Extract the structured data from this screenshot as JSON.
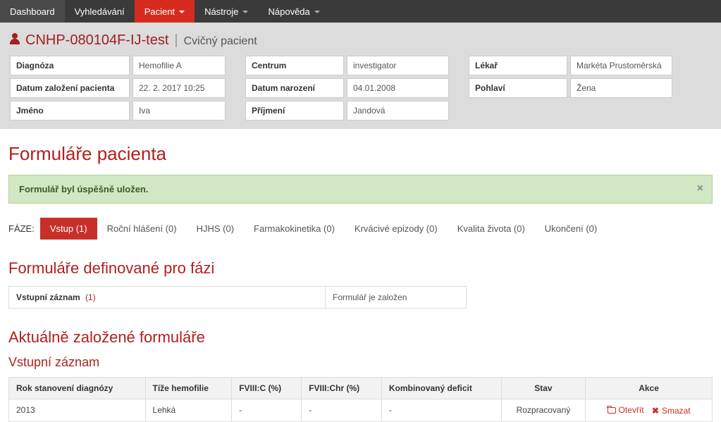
{
  "nav": {
    "dashboard": "Dashboard",
    "search": "Vyhledávání",
    "patient": "Pacient",
    "tools": "Nástroje",
    "help": "Nápověda"
  },
  "patient": {
    "id": "CNHP-080104F-IJ-test",
    "subtitle": "Cvičný pacient"
  },
  "info": {
    "diagnosis_label": "Diagnóza",
    "diagnosis_value": "Hemofilie A",
    "created_label": "Datum založení pacienta",
    "created_value": "22. 2. 2017 10:25",
    "firstname_label": "Jméno",
    "firstname_value": "Iva",
    "center_label": "Centrum",
    "center_value": "investigator",
    "birth_label": "Datum narození",
    "birth_value": "04.01.2008",
    "lastname_label": "Příjmení",
    "lastname_value": "Jandová",
    "doctor_label": "Lékař",
    "doctor_value": "Markéta Prustoměrská",
    "gender_label": "Pohlaví",
    "gender_value": "Žena"
  },
  "headings": {
    "forms": "Formuláře pacienta",
    "defined": "Formuláře definované pro fázi",
    "current": "Aktuálně založené formuláře",
    "entry": "Vstupní záznam"
  },
  "alert": {
    "message": "Formulář byl úspěšně uložen."
  },
  "phase": {
    "label": "FÁZE:",
    "tabs": [
      "Vstup (1)",
      "Roční hlášení (0)",
      "HJHS (0)",
      "Farmakokinetika (0)",
      "Krvácivé epizody (0)",
      "Kvalita života (0)",
      "Ukončení (0)"
    ]
  },
  "defined": {
    "name": "Vstupní záznam",
    "count": "(1)",
    "status": "Formulář je založen"
  },
  "table": {
    "headers": {
      "year": "Rok stanovení diagnózy",
      "severity": "Tíže hemofilie",
      "fviii_c": "FVIII:C (%)",
      "fviii_chr": "FVIII:Chr (%)",
      "combined": "Kombinovaný deficit",
      "state": "Stav",
      "actions": "Akce"
    },
    "row": {
      "year": "2013",
      "severity": "Lehká",
      "fviii_c": "-",
      "fviii_chr": "-",
      "combined": "-",
      "state": "Rozpracovaný"
    },
    "actions": {
      "open": "Otevřít",
      "delete": "Smazat"
    }
  }
}
